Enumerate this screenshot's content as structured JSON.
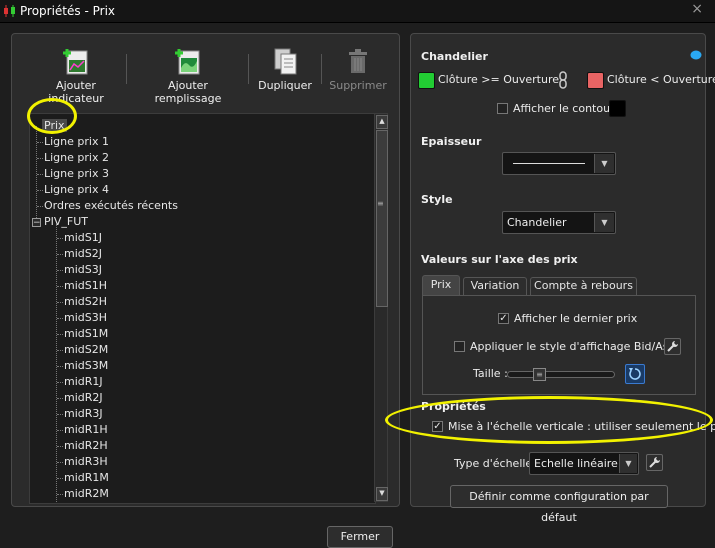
{
  "window": {
    "title": "Propriétés - Prix",
    "close": "×"
  },
  "toolbar": {
    "add_indicator": "Ajouter indicateur",
    "add_fill": "Ajouter remplissage",
    "duplicate": "Dupliquer",
    "delete": "Supprimer"
  },
  "tree": {
    "root": "Prix",
    "items": [
      "Ligne prix 1",
      "Ligne prix 2",
      "Ligne prix 3",
      "Ligne prix 4",
      "Ordres exécutés récents"
    ],
    "group": "PIV_FUT",
    "children": [
      "midS1J",
      "midS2J",
      "midS3J",
      "midS1H",
      "midS2H",
      "midS3H",
      "midS1M",
      "midS2M",
      "midS3M",
      "midR1J",
      "midR2J",
      "midR3J",
      "midR1H",
      "midR2H",
      "midR3H",
      "midR1M",
      "midR2M"
    ],
    "collapse_symbol": "−"
  },
  "scrollbar": {
    "up": "▲",
    "down": "▼",
    "grip": "≡"
  },
  "candle": {
    "title": "Chandelier",
    "close_ge_open": "Clôture >= Ouverture",
    "close_lt_open": "Clôture < Ouverture",
    "show_outline": "Afficher le contour",
    "up_color": "#22cc33",
    "down_color": "#e86464",
    "outline_color": "#000000"
  },
  "thickness": {
    "title": "Epaisseur"
  },
  "style": {
    "title": "Style",
    "value": "Chandelier"
  },
  "axis_values": {
    "title": "Valeurs sur l'axe des prix",
    "tabs": [
      "Prix",
      "Variation",
      "Compte à rebours"
    ],
    "show_last_price": "Afficher le dernier prix",
    "bid_ask_style": "Appliquer le style d'affichage Bid/Ask",
    "size_label": "Taille :"
  },
  "properties": {
    "title": "Propriétés",
    "vertical_scale": "Mise à l'échelle verticale : utiliser seulement le prix",
    "scale_type_label": "Type d'échelle",
    "scale_type_value": "Echelle linéaire",
    "default_button": "Définir comme configuration par défaut"
  },
  "footer": {
    "close_button": "Fermer"
  },
  "colors": {
    "annotation": "#f2f200"
  }
}
